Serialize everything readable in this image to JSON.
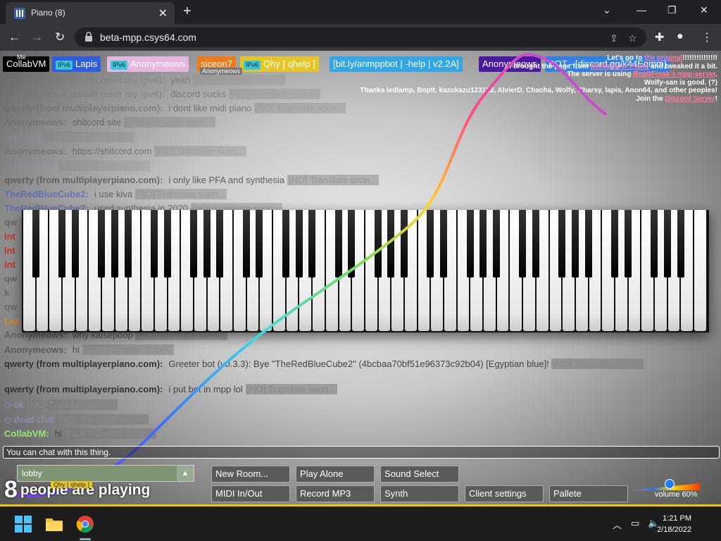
{
  "browser": {
    "tab_title": "Piano (8)",
    "url": "beta-mpp.csys64.com"
  },
  "userbar": {
    "me_label": "Me",
    "tooltip": "Anonymeows",
    "users": [
      {
        "name": "CollabVM",
        "color": "#000000",
        "ipv6": false
      },
      {
        "name": "Lapis",
        "color": "#2f5de0",
        "ipv6": true
      },
      {
        "name": "Anonymeows",
        "color": "#e4b6e0",
        "ipv6": true
      },
      {
        "name": "siceon7",
        "color": "#f07a1a",
        "ipv6": false
      },
      {
        "name": "Qhy [ qhelp ]",
        "color": "#e6c626",
        "ipv6": true
      },
      {
        "name": "[bit.ly/anmppbot | -help | v2.2A]",
        "color": "#32a6e6",
        "ipv6": false
      },
      {
        "name": "Anonymeows",
        "color": "#4a1aa0",
        "ipv6": false
      },
      {
        "name": "BOT - [discord.gg/k44Eqmm]",
        "color": "#2f80e8",
        "ipv6": false
      }
    ]
  },
  "announce": [
    {
      "pre": "Let's go to ",
      "link": "the original",
      "post": "!!!!!!!!!!!!!!!"
    },
    {
      "pre": "I brought the page from ",
      "link": "Multiplayer Piano",
      "post": " and tweaked it a bit."
    },
    {
      "pre": "The server is using ",
      "link": "BopItFreak's mpp-server",
      "post": "."
    },
    {
      "pre": "Wolfy-san is good. (?)",
      "link": "",
      "post": ""
    },
    {
      "pre": "Thanks ledlamp, BopIt, kazukazu123123, AlvierD, Chacha, Wolfy, Charsy, lapis, Anon64, and other peoples!",
      "link": "",
      "post": ""
    },
    {
      "pre": "Join the ",
      "link": "Discord Server",
      "post": "!"
    }
  ],
  "chat": [
    {
      "who": "Intel (Comcast do not reset my ipv6):",
      "text": "yeah",
      "tr": "[NO] Translate soon...",
      "color": "#777777",
      "fade": 0.35
    },
    {
      "who": "Intel (Comcast do not reset my ipv6):",
      "text": "discord sucks",
      "tr": "[NO] Translate soon...",
      "color": "#777777",
      "fade": 0.45
    },
    {
      "who": "qwerty (from multiplayerpiano.com):",
      "text": "i dont like midi piano",
      "tr": "[NO] Translate soon...",
      "color": "#666666",
      "fade": 0.55
    },
    {
      "who": "Anonymeows:",
      "text": "shitcord site",
      "tr": "[NO] Translate soon...",
      "color": "#666666",
      "fade": 0.6
    },
    {
      "who": "",
      "text": "kaisep",
      "tr": "[NO] Translate soon...",
      "color": "#9a8fbf",
      "fade": 0.4
    },
    {
      "who": "Anonymeows:",
      "text": "https://shitcord.com",
      "tr": "[NO] Translate soon...",
      "color": "#666666",
      "fade": 0.55
    },
    {
      "who": "",
      "text": "kaisepoop",
      "tr": "[NO] Translate soon...",
      "color": "#9a8fbf",
      "fade": 0.35
    },
    {
      "who": "qwerty (from multiplayerpiano.com):",
      "text": "i only like PFA and synthesia",
      "tr": "[NO] Translate soon...",
      "color": "#555555",
      "fade": 0.8
    },
    {
      "who": "TheRedBlueCube2:",
      "text": "i use kiva",
      "tr": "[NO] Translate soon...",
      "color": "#4e5fc8",
      "fade": 0.7
    },
    {
      "who": "TheRedBlueCube2:",
      "text": "used synthesia in 2020",
      "tr": "[NO] Translate soon...",
      "color": "#4e5fc8",
      "fade": 0.6
    }
  ],
  "chat_lower": [
    {
      "who": "Anonymeows:",
      "text": "why kaisepoop",
      "tr": "[NO] Translate soon...",
      "color": "#555555",
      "fade": 0.75
    },
    {
      "who": "Anonymeows:",
      "text": "hi",
      "tr": "[NO] Translate soon...",
      "color": "#555555",
      "fade": 0.9
    },
    {
      "who": "qwerty (from multiplayerpiano.com):",
      "text": "Greeter bot (v0.3.3): Bye \"TheRedBlueCube2\" (4bcbaa70bf51e96373c92b04) [Egyptian blue]!",
      "tr": "[NO] Translate soon...",
      "color": "#333333",
      "fade": 1.0
    },
    {
      "who": "qwerty (from multiplayerpiano.com):",
      "text": "i put bot in mpp lol",
      "tr": "[NO] Translate soon...",
      "color": "#333333",
      "fade": 1.0
    },
    {
      "who": "",
      "text": "ok",
      "tr": "[NO] Translate soon...",
      "color": "#9a8fbf",
      "fade": 1.0
    },
    {
      "who": "",
      "text": "dead chat",
      "tr": "[NO] Translate soon...",
      "color": "#9a8fbf",
      "fade": 1.0
    },
    {
      "who": "CollabVM:",
      "text": "hi",
      "tr": "[NO] Translate soon...",
      "color": "#9be27a",
      "fade": 1.0
    }
  ],
  "chat_partial": [
    "qw",
    "Int",
    "Int",
    "Int",
    "qw",
    "k",
    "qw",
    "Lap"
  ],
  "chat_input_placeholder": "You can chat with this thing.",
  "room": {
    "name": "lobby"
  },
  "playing": {
    "count": "8",
    "text": "people are playing",
    "tag": "Qhy [ qhelp ]"
  },
  "buttons": {
    "new_room": "New Room...",
    "play_alone": "Play Alone",
    "sound_select": "Sound Select",
    "midi": "MIDI In/Out",
    "record": "Record MP3",
    "synth": "Synth",
    "client_settings": "Client settings",
    "pallete": "Pallete"
  },
  "volume": {
    "label": "volume 60%",
    "value": 0.6
  },
  "taskbar": {
    "time": "1:21 PM",
    "date": "2/18/2022"
  }
}
